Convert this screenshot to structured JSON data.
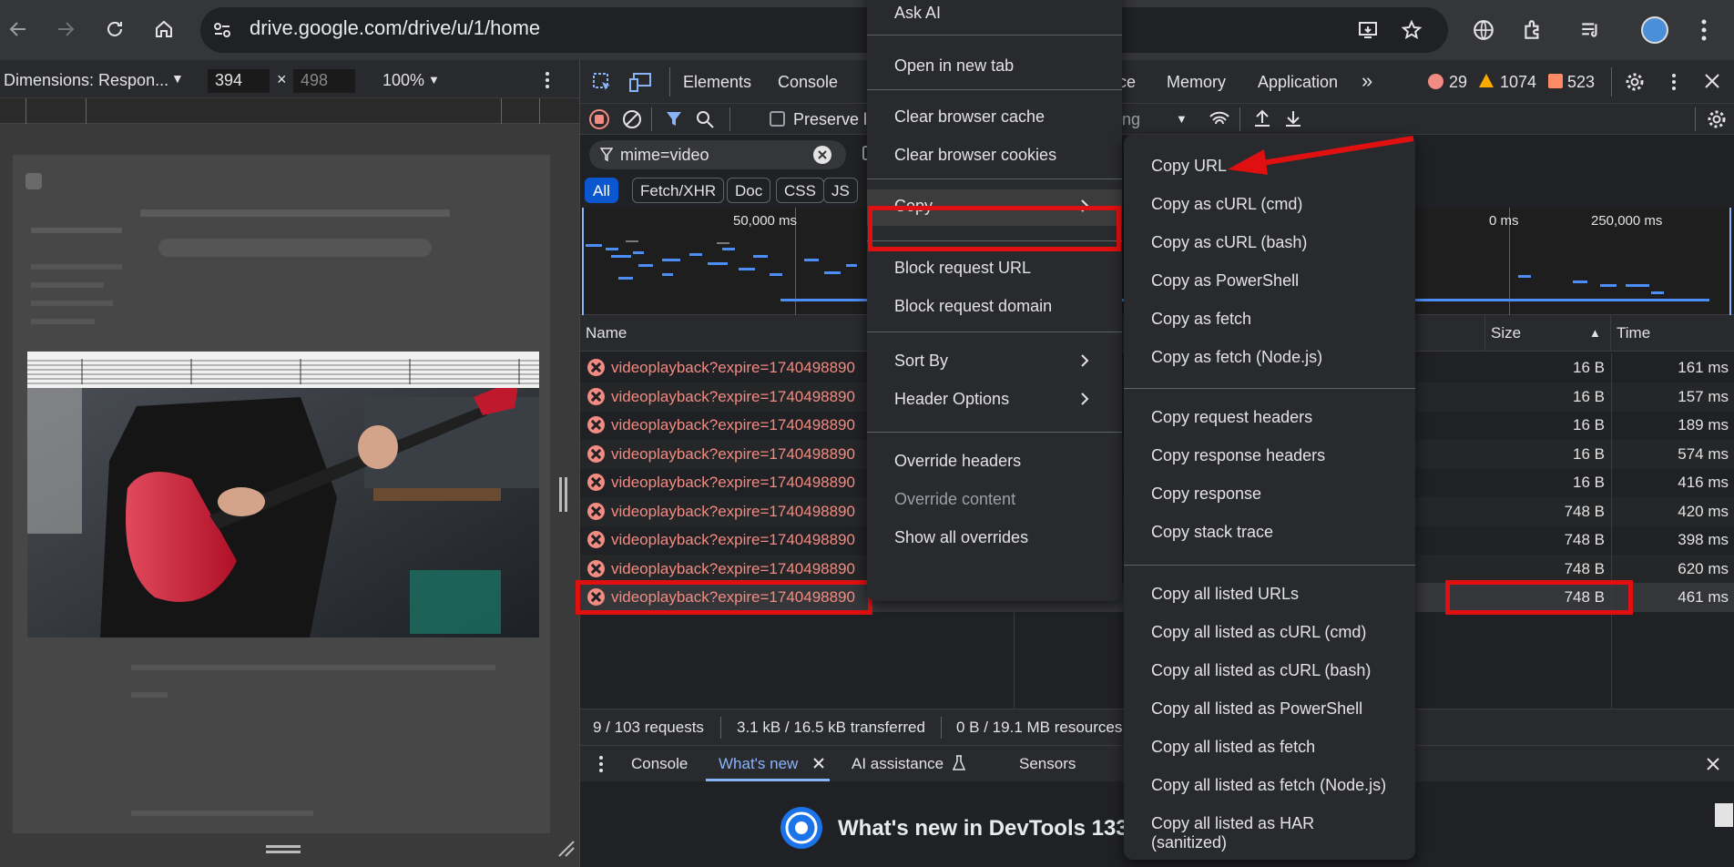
{
  "browser": {
    "url": "drive.google.com/drive/u/1/home"
  },
  "device_toolbar": {
    "dimensions_label": "Dimensions: Respon...",
    "width": "394",
    "height": "498",
    "zoom": "100%",
    "times_sign": "×"
  },
  "devtools": {
    "tabs": [
      "Elements",
      "Console",
      "ce",
      "Memory",
      "Application"
    ],
    "more_tabs": "»",
    "error_count": "29",
    "warning_count": "1074",
    "info_count": "523",
    "preserve_log": "Preserve lo",
    "throttling": "ling",
    "filter_value": "mime=video",
    "type_chips": [
      "All",
      "Fetch/XHR",
      "Doc",
      "CSS",
      "JS"
    ],
    "timeline_labels": [
      "50,000 ms",
      "0 ms",
      "250,000 ms"
    ],
    "columns": {
      "name": "Name",
      "size": "Size",
      "time": "Time"
    },
    "rows": [
      {
        "name": "videoplayback?expire=1740498890",
        "size": "16 B",
        "time": "161 ms"
      },
      {
        "name": "videoplayback?expire=1740498890",
        "size": "16 B",
        "time": "157 ms"
      },
      {
        "name": "videoplayback?expire=1740498890",
        "size": "16 B",
        "time": "189 ms"
      },
      {
        "name": "videoplayback?expire=1740498890",
        "size": "16 B",
        "time": "574 ms"
      },
      {
        "name": "videoplayback?expire=1740498890",
        "size": "16 B",
        "time": "416 ms"
      },
      {
        "name": "videoplayback?expire=1740498890",
        "size": "748 B",
        "time": "420 ms"
      },
      {
        "name": "videoplayback?expire=1740498890",
        "size": "748 B",
        "time": "398 ms"
      },
      {
        "name": "videoplayback?expire=1740498890",
        "size": "748 B",
        "time": "620 ms"
      },
      {
        "name": "videoplayback?expire=1740498890",
        "size": "748 B",
        "time": "461 ms"
      }
    ],
    "status": {
      "requests": "9 / 103 requests",
      "transferred": "3.1 kB / 16.5 kB transferred",
      "resources": "0 B / 19.1 MB resources"
    },
    "drawer_tabs": [
      "Console",
      "What's new",
      "AI assistance",
      "Sensors"
    ],
    "whatsnew_title": "What's new in DevTools 133"
  },
  "context_menu": {
    "items": [
      {
        "label": "Ask AI"
      },
      {
        "label": "Open in new tab"
      },
      {
        "label": "Clear browser cache"
      },
      {
        "label": "Clear browser cookies"
      },
      {
        "label": "Copy"
      },
      {
        "label": "Block request URL"
      },
      {
        "label": "Block request domain"
      },
      {
        "label": "Sort By"
      },
      {
        "label": "Header Options"
      },
      {
        "label": "Override headers"
      },
      {
        "label": "Override content"
      },
      {
        "label": "Show all overrides"
      }
    ]
  },
  "copy_submenu": {
    "items": [
      {
        "label": "Copy URL"
      },
      {
        "label": "Copy as cURL (cmd)"
      },
      {
        "label": "Copy as cURL (bash)"
      },
      {
        "label": "Copy as PowerShell"
      },
      {
        "label": "Copy as fetch"
      },
      {
        "label": "Copy as fetch (Node.js)"
      },
      {
        "label": "Copy request headers"
      },
      {
        "label": "Copy response headers"
      },
      {
        "label": "Copy response"
      },
      {
        "label": "Copy stack trace"
      },
      {
        "label": "Copy all listed URLs"
      },
      {
        "label": "Copy all listed as cURL (cmd)"
      },
      {
        "label": "Copy all listed as cURL (bash)"
      },
      {
        "label": "Copy all listed as PowerShell"
      },
      {
        "label": "Copy all listed as fetch"
      },
      {
        "label": "Copy all listed as fetch (Node.js)"
      },
      {
        "label": "Copy all listed as HAR (sanitized)"
      }
    ]
  },
  "colors": {
    "annotation_red": "#e01010",
    "error_red": "#f28b82",
    "accent_blue": "#8ab4f8"
  }
}
